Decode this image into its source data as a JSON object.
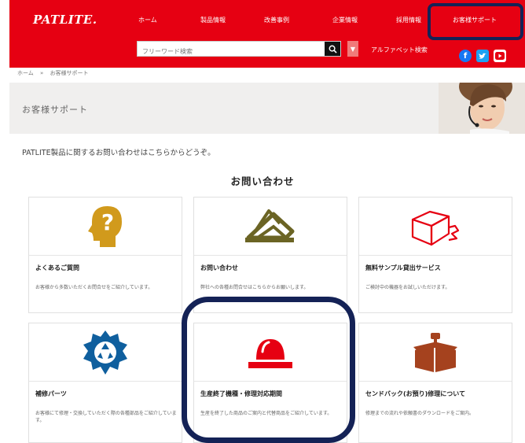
{
  "header": {
    "logo": "PATLITE.",
    "nav": [
      "ホーム",
      "製品情報",
      "改善事例",
      "企業情報",
      "採用情報",
      "お客様サポート"
    ],
    "search": {
      "placeholder": "フリーワード検索"
    },
    "alphabet_search": "アルファベット検索",
    "sns": [
      "facebook",
      "twitter",
      "youtube"
    ],
    "brand_color": "#e60012"
  },
  "breadcrumb": {
    "home": "ホーム",
    "sep": "»",
    "current": "お客様サポート"
  },
  "banner": {
    "title": "お客様サポート"
  },
  "intro": "PATLITE製品に関するお問い合わせはこちらからどうぞ。",
  "section_title": "お問い合わせ",
  "cards": [
    {
      "title": "よくあるご質問",
      "desc": "お客様から多数いただくお問合せをご紹介しています。",
      "icon": "faq-head-icon"
    },
    {
      "title": "お問い合わせ",
      "desc": "弊社への各種お問合せはこちらからお願いします。",
      "icon": "envelope-icon"
    },
    {
      "title": "無料サンプル貸出サービス",
      "desc": "ご検討中の機器をお試しいただけます。",
      "icon": "box-icon"
    },
    {
      "title": "補修パーツ",
      "desc": "お客様にて修理・交換していただく際の各種部品をご紹介しています。",
      "icon": "recycle-gear-icon"
    },
    {
      "title": "生産終了機種・修理対応期間",
      "desc": "生産を終了した商品のご案内と代替商品をご紹介しています。",
      "icon": "warning-light-icon"
    },
    {
      "title": "センドバック(お預り)修理について",
      "desc": "修理までの流れや依頼書のダウンロードをご案内。",
      "icon": "repair-box-icon"
    }
  ],
  "colors": {
    "highlight": "#142256",
    "faq": "#d19a1c",
    "envelope": "#6b6424",
    "red": "#e60012",
    "recycle": "#0f5f9e",
    "box": "#a5421e"
  }
}
